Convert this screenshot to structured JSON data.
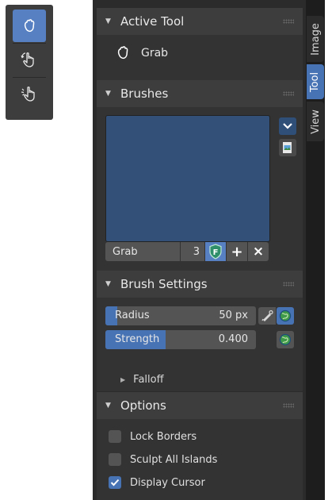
{
  "toolbar": {
    "tools": [
      {
        "icon": "grab-hand-icon",
        "active": true
      },
      {
        "icon": "rotate-hand-icon",
        "active": false
      },
      {
        "icon": "relax-hand-icon",
        "active": false
      }
    ]
  },
  "panels": {
    "active_tool": {
      "title": "Active Tool",
      "tool_label": "Grab",
      "tool_icon": "grab-hand-icon"
    },
    "brushes": {
      "title": "Brushes",
      "brush_name": "Grab",
      "user_count": "3",
      "fake_user_label": "F",
      "add_label": "+",
      "remove_label": "×",
      "dropdown_icon": "chevron-down-icon",
      "browse_icon": "image-browse-icon"
    },
    "brush_settings": {
      "title": "Brush Settings",
      "radius": {
        "label": "Radius",
        "value": "50 px",
        "fill": 0.08
      },
      "strength": {
        "label": "Strength",
        "value": "0.400",
        "fill": 0.4
      },
      "falloff_label": "Falloff"
    },
    "options": {
      "title": "Options",
      "checkboxes": [
        {
          "label": "Lock Borders",
          "checked": false
        },
        {
          "label": "Sculpt All Islands",
          "checked": false
        },
        {
          "label": "Display Cursor",
          "checked": true
        }
      ]
    }
  },
  "tabs": [
    {
      "label": "Image",
      "active": false
    },
    {
      "label": "Tool",
      "active": true
    },
    {
      "label": "View",
      "active": false
    }
  ],
  "colors": {
    "accent": "#4772b3",
    "header": "#3d3d3d",
    "background": "#2b2b2b"
  }
}
